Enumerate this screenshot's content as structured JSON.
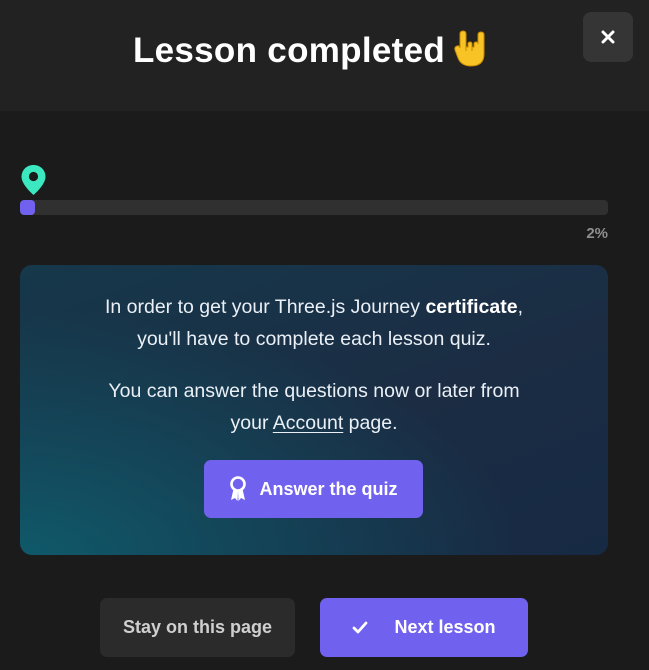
{
  "modal": {
    "title": "Lesson completed",
    "title_emoji": "🤘",
    "close_icon": "close-icon"
  },
  "progress": {
    "value": 0.02,
    "label": "2%",
    "marker_icon": "map-pin-icon",
    "fill_color": "#7161ef"
  },
  "info": {
    "line1_pre": "In order to get your Three.js Journey ",
    "line1_bold": "certificate",
    "line1_post": ",",
    "line2": "you'll have to complete each lesson quiz.",
    "line3": "You can answer the questions now or later from",
    "line4_pre": "your ",
    "line4_link": "Account",
    "line4_post": " page."
  },
  "quiz_button": {
    "label": "Answer the quiz",
    "icon": "award-ribbon-icon"
  },
  "actions": {
    "stay_label": "Stay on this page",
    "next_label": "Next lesson",
    "next_icon": "checkmark-icon"
  },
  "colors": {
    "accent": "#7161ef",
    "pin": "#3be8c0",
    "background": "#1b1b1b"
  }
}
